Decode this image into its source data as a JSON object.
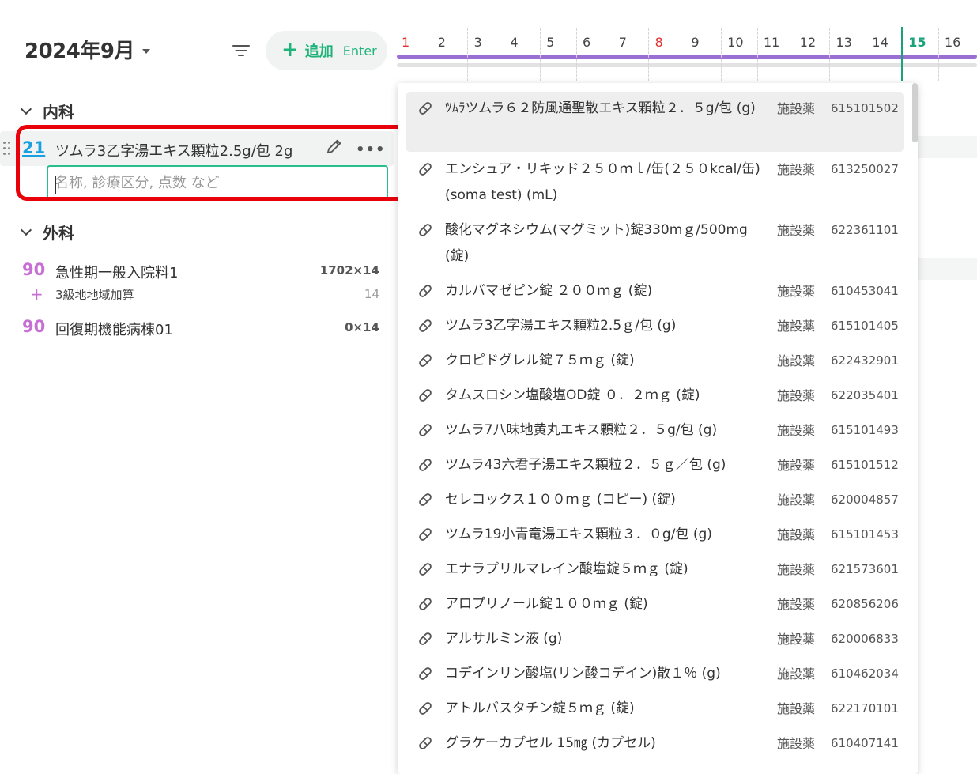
{
  "header": {
    "month_label": "2024年9月",
    "add_button_label": "追加",
    "add_button_key": "Enter"
  },
  "calendar": {
    "days": [
      "1",
      "2",
      "3",
      "4",
      "5",
      "6",
      "7",
      "8",
      "9",
      "10",
      "11",
      "12",
      "13",
      "14",
      "15",
      "16"
    ],
    "today": "15",
    "holidays": [
      "1",
      "8"
    ]
  },
  "sections": [
    {
      "title": "内科",
      "rows": [
        {
          "number": "21",
          "name": "ツムラ3乙字湯エキス顆粒2.5g/包 2g"
        }
      ]
    },
    {
      "title": "外科",
      "rows": [
        {
          "number": "90",
          "name": "急性期一般入院料1",
          "qty": "1702×14",
          "sub": {
            "name": "3級地地域加算",
            "qty": "14"
          }
        },
        {
          "number": "90",
          "name": "回復期機能病棟01",
          "qty": "0×14"
        }
      ]
    }
  ],
  "search": {
    "placeholder": "名称, 診療区分, 点数 など"
  },
  "dropdown": {
    "items": [
      {
        "name": "ﾂﾑﾗツムラ６２防風通聖散エキス顆粒２．５g/包 (g)",
        "category": "施設薬",
        "code": "615101502"
      },
      {
        "name": "エンシュア・リキッド２５０ｍｌ/缶(２５０kcal/缶) (soma test) (mL)",
        "category": "施設薬",
        "code": "613250027"
      },
      {
        "name": "酸化マグネシウム(マグミット)錠330mｇ/500mg (錠)",
        "category": "施設薬",
        "code": "622361101"
      },
      {
        "name": "カルバマゼピン錠 ２００ｍｇ (錠)",
        "category": "施設薬",
        "code": "610453041"
      },
      {
        "name": "ツムラ3乙字湯エキス顆粒2.5ｇ/包 (g)",
        "category": "施設薬",
        "code": "615101405"
      },
      {
        "name": "クロピドグレル錠７５ｍｇ (錠)",
        "category": "施設薬",
        "code": "622432901"
      },
      {
        "name": "タムスロシン塩酸塩OD錠 ０．２ｍｇ (錠)",
        "category": "施設薬",
        "code": "622035401"
      },
      {
        "name": "ツムラ7八味地黄丸エキス顆粒２．５g/包 (g)",
        "category": "施設薬",
        "code": "615101493"
      },
      {
        "name": "ツムラ43六君子湯エキス顆粒２．５ｇ／包 (g)",
        "category": "施設薬",
        "code": "615101512"
      },
      {
        "name": "セレコックス１００ｍｇ (コピー) (錠)",
        "category": "施設薬",
        "code": "620004857"
      },
      {
        "name": "ツムラ19小青竜湯エキス顆粒３．０g/包 (g)",
        "category": "施設薬",
        "code": "615101453"
      },
      {
        "name": "エナラプリルマレイン酸塩錠５ｍｇ (錠)",
        "category": "施設薬",
        "code": "621573601"
      },
      {
        "name": "アロプリノール錠１００ｍｇ (錠)",
        "category": "施設薬",
        "code": "620856206"
      },
      {
        "name": "アルサルミン液 (g)",
        "category": "施設薬",
        "code": "620006833"
      },
      {
        "name": "コデインリン酸塩(リン酸コデイン)散１％ (g)",
        "category": "施設薬",
        "code": "610462034"
      },
      {
        "name": "アトルバスタチン錠５ｍｇ (錠)",
        "category": "施設薬",
        "code": "622170101"
      },
      {
        "name": "グラケーカプセル 15㎎ (カプセル)",
        "category": "施設薬",
        "code": "610407141"
      }
    ]
  },
  "colors": {
    "accent_green": "#1fb37a",
    "blue_number": "#1aa0e0",
    "purple_number": "#c76fd4",
    "highlight_red": "#e8000b",
    "calendar_bar": "#9b6ed6"
  }
}
